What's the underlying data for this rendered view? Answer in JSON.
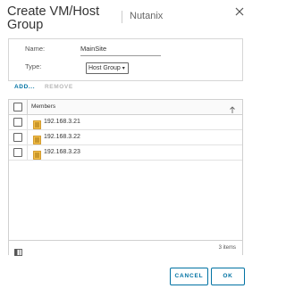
{
  "dialog": {
    "title": "Create VM/Host Group",
    "subtitle": "Nutanix"
  },
  "form": {
    "name_label": "Name:",
    "name_value": "MainSite",
    "type_label": "Type:",
    "type_value": "Host Group"
  },
  "actions": {
    "add": "ADD...",
    "remove": "REMOVE"
  },
  "grid": {
    "column_header": "Members",
    "rows": [
      {
        "label": "192.168.3.21"
      },
      {
        "label": "192.168.3.22"
      },
      {
        "label": "192.168.3.23"
      }
    ],
    "item_count": "3 items"
  },
  "buttons": {
    "cancel": "CANCEL",
    "ok": "OK"
  },
  "colors": {
    "accent": "#0072a3",
    "host_icon": "#e8a317"
  }
}
